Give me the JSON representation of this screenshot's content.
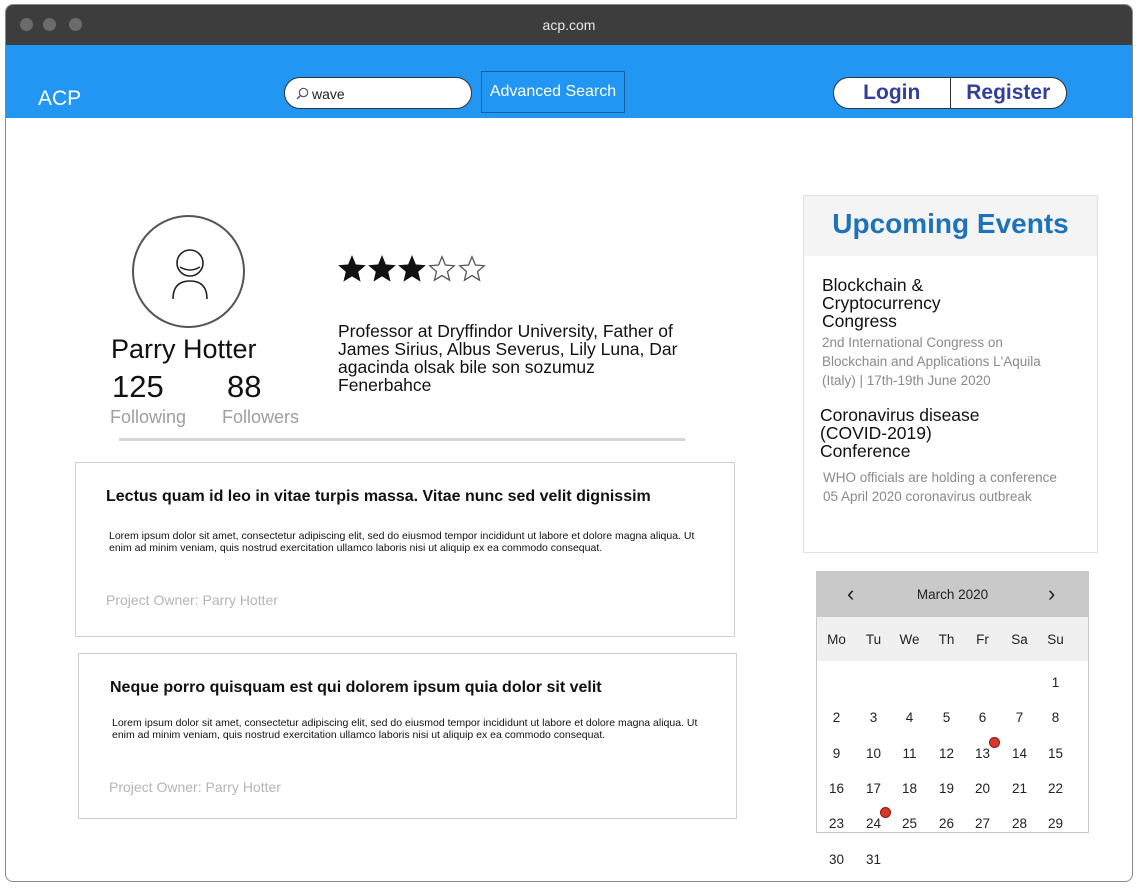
{
  "window": {
    "url": "acp.com"
  },
  "navbar": {
    "brand": "ACP",
    "search_value": "wave",
    "advanced_search_label": "Advanced Search",
    "login_label": "Login",
    "register_label": "Register"
  },
  "profile": {
    "name": "Parry Hotter",
    "following_count": "125",
    "following_label": "Following",
    "followers_count": "88",
    "followers_label": "Followers",
    "rating": 3,
    "rating_max": 5,
    "bio": "Professor at Dryffindor University, Father of James Sirius, Albus Severus, Lily Luna, Dar agacinda olsak bile son sozumuz Fenerbahce"
  },
  "projects": [
    {
      "title": "Lectus quam id leo in vitae turpis massa. Vitae nunc sed velit dignissim",
      "body": "Lorem ipsum dolor sit amet, consectetur adipiscing elit, sed do eiusmod tempor incididunt ut labore et dolore magna aliqua. Ut enim ad minim veniam, quis nostrud exercitation ullamco laboris nisi ut aliquip ex ea commodo consequat.",
      "owner": "Project Owner: Parry Hotter"
    },
    {
      "title": "Neque porro quisquam est qui dolorem ipsum quia dolor sit velit",
      "body": "Lorem ipsum dolor sit amet, consectetur adipiscing elit, sed do eiusmod tempor incididunt ut labore et dolore magna aliqua. Ut enim ad minim veniam, quis nostrud exercitation ullamco laboris nisi ut aliquip ex ea commodo consequat.",
      "owner": "Project Owner: Parry Hotter"
    }
  ],
  "events": {
    "heading": "Upcoming Events",
    "items": [
      {
        "title": "Blockchain & Cryptocurrency Congress",
        "desc": "2nd International Congress on Blockchain and Applications L'Aquila (Italy) | 17th-19th June 2020"
      },
      {
        "title": "Coronavirus disease (COVID-2019) Conference",
        "desc": "WHO officials are holding a conference 05 April 2020 coronavirus outbreak"
      }
    ]
  },
  "calendar": {
    "month": "March 2020",
    "prev_icon": "‹",
    "next_icon": "›",
    "weekdays": [
      "Mo",
      "Tu",
      "We",
      "Th",
      "Fr",
      "Sa",
      "Su"
    ],
    "first_weekday_index": 6,
    "days_in_month": 31,
    "event_days": [
      13,
      24
    ],
    "marker_color": "#d9372b"
  },
  "colors": {
    "navbar": "#2196f3",
    "events_heading": "#1e73b8",
    "auth_text": "#33409a"
  }
}
